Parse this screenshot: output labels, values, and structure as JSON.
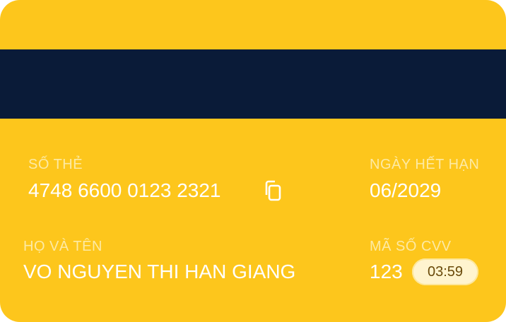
{
  "card": {
    "brand_color": "#fdc61c",
    "stripe_color": "#0a1b38",
    "number_label": "SỐ THẺ",
    "number": "4748 6600 0123 2321",
    "copy_icon": "copy-icon",
    "expiry_label": "NGÀY HẾT HẠN",
    "expiry": "06/2029",
    "holder_label": "HỌ VÀ TÊN",
    "holder": "VO NGUYEN THI HAN GIANG",
    "cvv_label": "MÃ SỐ CVV",
    "cvv": "123",
    "cvv_timer": "03:59"
  }
}
